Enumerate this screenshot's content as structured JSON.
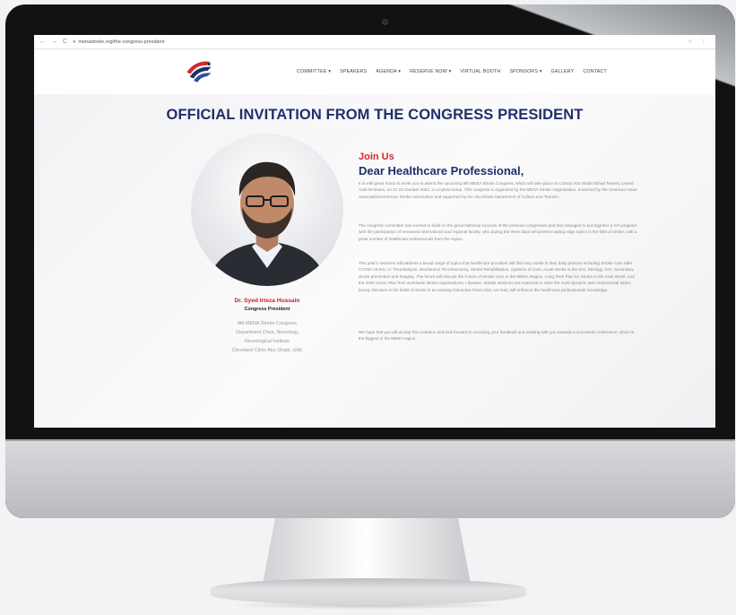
{
  "browser": {
    "url": "menastroke.org/the-congress-president",
    "nav_back": "←",
    "nav_forward": "→",
    "reload": "C",
    "right_icons": "☆ ⋮"
  },
  "menu": {
    "items": [
      "COMMITTEE ▾",
      "SPEAKERS",
      "AGENDA ▾",
      "RESERVE NOW ▾",
      "VIRTUAL BOOTH",
      "SPONSORS ▾",
      "GALLERY",
      "CONTACT"
    ]
  },
  "page": {
    "title": "OFFICIAL INVITATION FROM THE CONGRESS PRESIDENT",
    "join": "Join Us",
    "dear": "Dear Healthcare Professional,",
    "paragraphs": [
      "It is with great honor to invite you to attend the upcoming 8th MENA Stroke Congress, which will take place at Conrad Abu Dhabi Etihad Towers, United Arab Emirates, on 21-23 October 2022, in a hybrid setup. This congress is organized by the MENA Stroke Organization, endorsed by the American Heart Association/American Stroke Association and supported by the Abu Dhabi Department of Culture and Tourism.",
      "The congress committee has worked to build on the great historical success of the previous congresses and has managed to put together a rich program with the participation of renowned international and regional faculty, who during the three days will present cutting edge topics in the field of stroke, with a great number of healthcare professionals from the region.",
      "This year's sessions will address a broad range of topics that healthcare providers will find very useful in their daily practice including Stroke Care after COVID-19 Era, IV Thrombolysis, Mechanical Thrombectomy, Stroke Rehabilitation, Systems of Care, Acute stroke in the ICU, Etiology, ICH, Secondary stroke prevention and Imaging. The forum will discuss the Future of Stroke Care in the MENA Region, Long Term Plan for Stroke in the Arab World, and the 2030 Action Plan from worldwide stroke organizations. Likewise, debate sessions are expected to raise the most dynamic and controversial topics facing clinicians in the fields of stroke in an exciting interactive forum that, we trust, will enhance the healthcare professionals' knowledge.",
      "We hope that you will accept this invitation and look forward to receiving your feedback and working with you towards a successful conference, which is the biggest in the MENA region."
    ]
  },
  "president": {
    "name": "Dr. Syed Irteza Hussain",
    "role": "Congress President",
    "details": [
      "8th MENA Stroke Congress",
      "Department Chair, Neurology",
      "Neurological Institute",
      "Cleveland Clinic Abu Dhabi, UAE"
    ]
  },
  "colors": {
    "title_blue": "#1f2f6b",
    "accent_red": "#d32a2e"
  }
}
